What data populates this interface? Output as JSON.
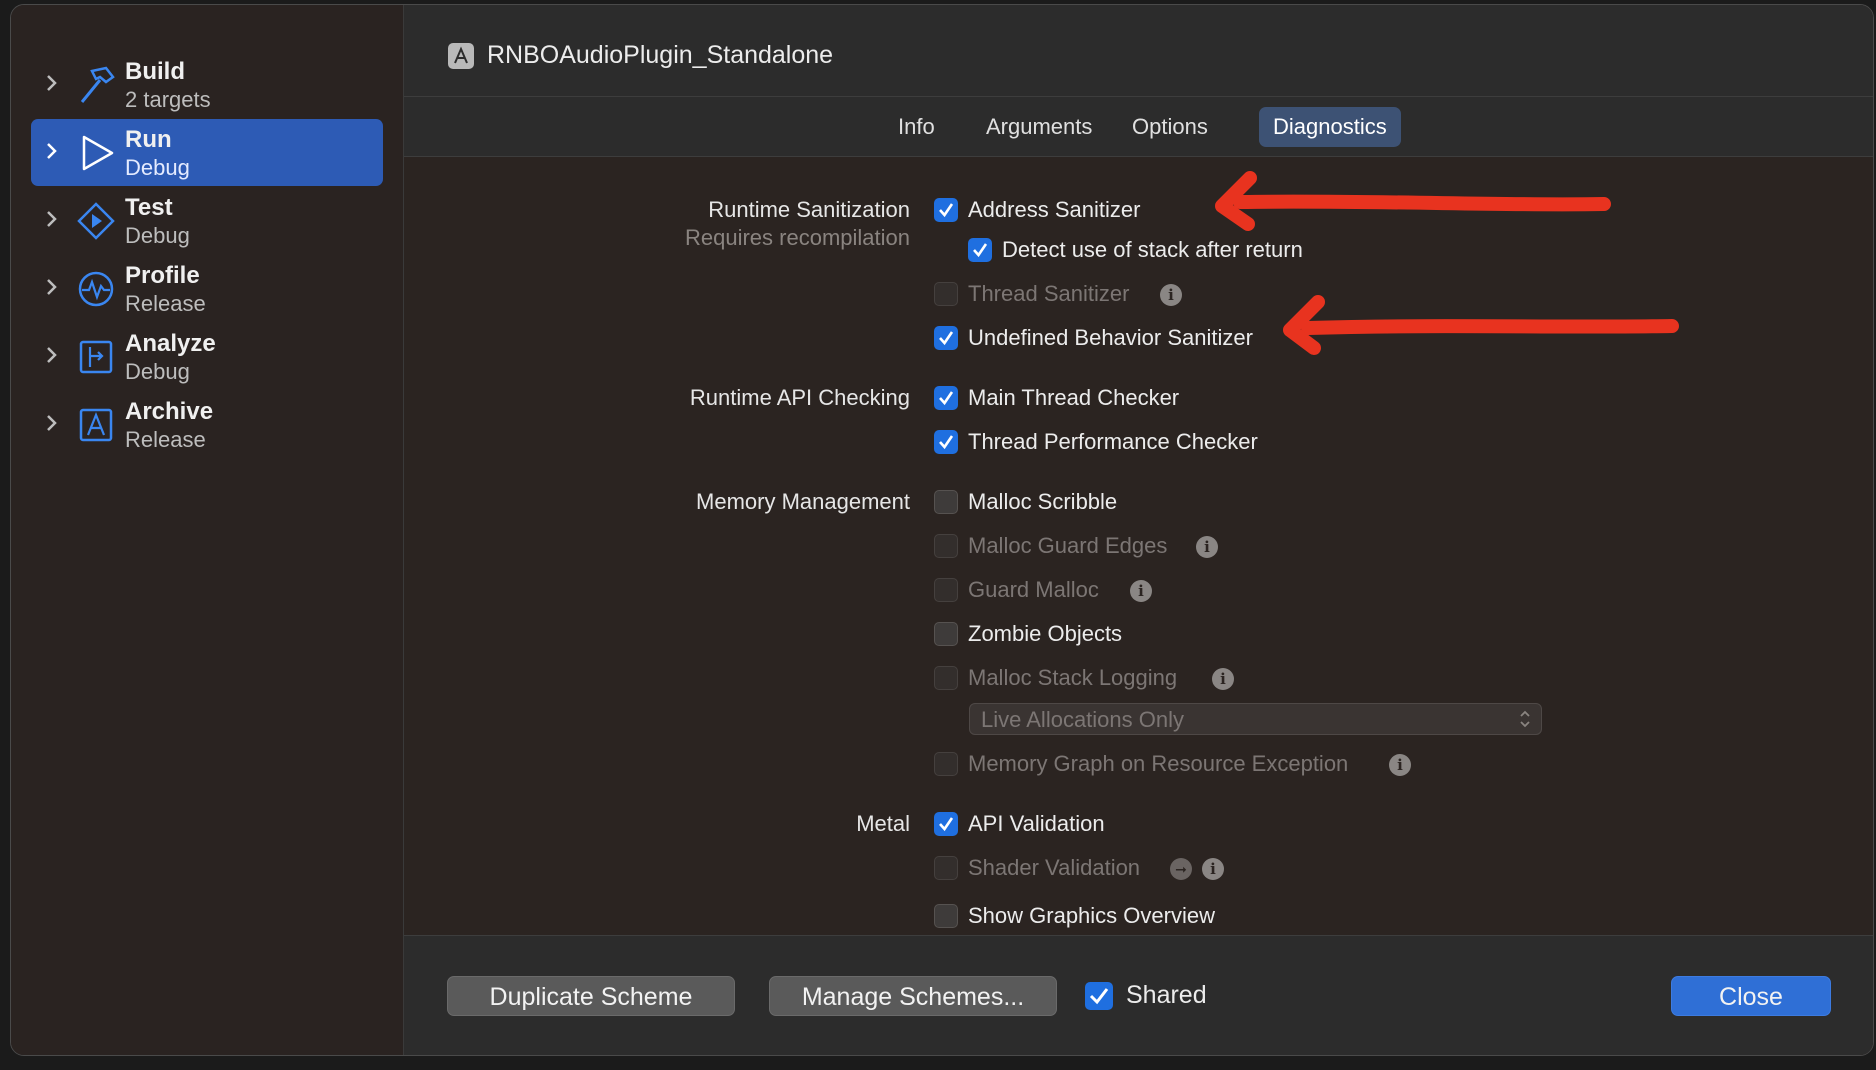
{
  "sidebar": {
    "items": [
      {
        "title": "Build",
        "subtitle": "2 targets",
        "icon": "hammer-icon"
      },
      {
        "title": "Run",
        "subtitle": "Debug",
        "icon": "play-icon",
        "selected": true
      },
      {
        "title": "Test",
        "subtitle": "Debug",
        "icon": "test-diamond-icon"
      },
      {
        "title": "Profile",
        "subtitle": "Release",
        "icon": "profile-gauge-icon"
      },
      {
        "title": "Analyze",
        "subtitle": "Debug",
        "icon": "analyze-icon"
      },
      {
        "title": "Archive",
        "subtitle": "Release",
        "icon": "archive-icon"
      }
    ]
  },
  "header": {
    "target_name": "RNBOAudioPlugin_Standalone",
    "icon": "app-target-icon"
  },
  "tabs": [
    {
      "label": "Info"
    },
    {
      "label": "Arguments"
    },
    {
      "label": "Options"
    },
    {
      "label": "Diagnostics",
      "active": true
    }
  ],
  "diagnostics": {
    "runtime_sanitization": {
      "label": "Runtime Sanitization",
      "sublabel": "Requires recompilation",
      "address_sanitizer": {
        "label": "Address Sanitizer",
        "checked": true
      },
      "stack_after_return": {
        "label": "Detect use of stack after return",
        "checked": true
      },
      "thread_sanitizer": {
        "label": "Thread Sanitizer",
        "checked": false,
        "enabled": false
      },
      "ub_sanitizer": {
        "label": "Undefined Behavior Sanitizer",
        "checked": true
      }
    },
    "runtime_api": {
      "label": "Runtime API Checking",
      "main_thread_checker": {
        "label": "Main Thread Checker",
        "checked": true
      },
      "thread_performance_checker": {
        "label": "Thread Performance Checker",
        "checked": true
      }
    },
    "memory": {
      "label": "Memory Management",
      "malloc_scribble": {
        "label": "Malloc Scribble",
        "checked": false
      },
      "malloc_guard_edges": {
        "label": "Malloc Guard Edges",
        "checked": false,
        "enabled": false
      },
      "guard_malloc": {
        "label": "Guard Malloc",
        "checked": false,
        "enabled": false
      },
      "zombie_objects": {
        "label": "Zombie Objects",
        "checked": false
      },
      "malloc_stack_logging": {
        "label": "Malloc Stack Logging",
        "checked": false,
        "enabled": false
      },
      "stack_logging_mode": {
        "value": "Live Allocations Only"
      },
      "memory_graph": {
        "label": "Memory Graph on Resource Exception",
        "checked": false,
        "enabled": false
      }
    },
    "metal": {
      "label": "Metal",
      "api_validation": {
        "label": "API Validation",
        "checked": true
      },
      "shader_validation": {
        "label": "Shader Validation",
        "checked": false,
        "enabled": false
      },
      "graphics_overview": {
        "label": "Show Graphics Overview",
        "checked": false
      }
    }
  },
  "footer": {
    "duplicate_label": "Duplicate Scheme",
    "manage_label": "Manage Schemes...",
    "shared_label": "Shared",
    "shared_checked": true,
    "close_label": "Close"
  },
  "info_glyph": "i",
  "colors": {
    "accent": "#1f6fe0",
    "selection": "#2d5bb5",
    "annotation": "#e8331f"
  }
}
